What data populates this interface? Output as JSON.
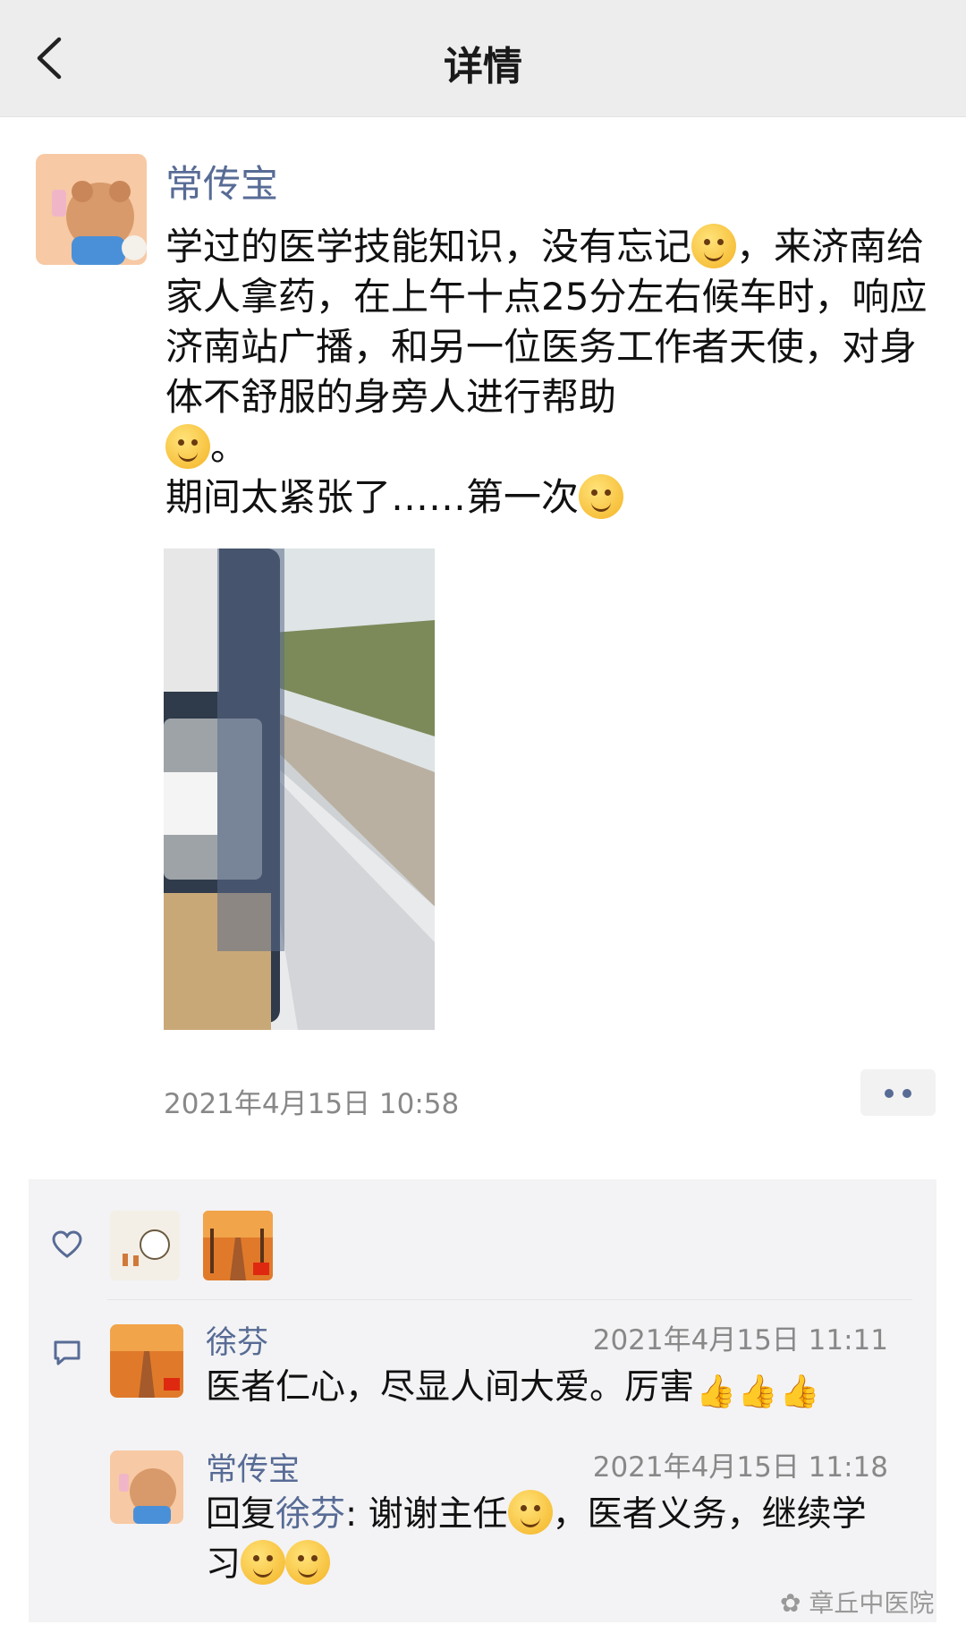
{
  "header": {
    "title": "详情",
    "back_icon": "chevron-left-icon"
  },
  "post": {
    "author": "常传宝",
    "text_parts": [
      "学过的医学技能知识，没有忘记",
      "，来济南给家人拿药，在上午十点25分左右候车时，响应济南站广播，和另一位医务工作者天使，对身体不舒服的身旁人进行帮助",
      "。",
      "期间太紧张了……第一次"
    ],
    "emojis": [
      "wink-tongue-emoji",
      "smile-emoji",
      "crying-emoji"
    ],
    "photo": "train-window-photo",
    "timestamp": "2021年4月15日 10:58"
  },
  "likes": {
    "icon": "heart-icon",
    "avatars": [
      "like-avatar-cartoon",
      "like-avatar-autumn-road"
    ]
  },
  "comments": [
    {
      "author": "徐芬",
      "time": "2021年4月15日 11:11",
      "text": "医者仁心，尽显人间大爱。厉害",
      "thumbs": [
        "thumbs-up-emoji",
        "thumbs-up-emoji",
        "thumbs-up-emoji"
      ]
    },
    {
      "author": "常传宝",
      "time": "2021年4月15日 11:18",
      "reply_prefix": "回复",
      "reply_to": "徐芬",
      "text_1": ": 谢谢主任",
      "text_2": "，医者义务，继续学",
      "text_3": "习"
    }
  ],
  "watermark": "章丘中医院",
  "colors": {
    "link": "#576b95",
    "nav_bg": "#ededed",
    "panel_bg": "#f3f3f5"
  }
}
